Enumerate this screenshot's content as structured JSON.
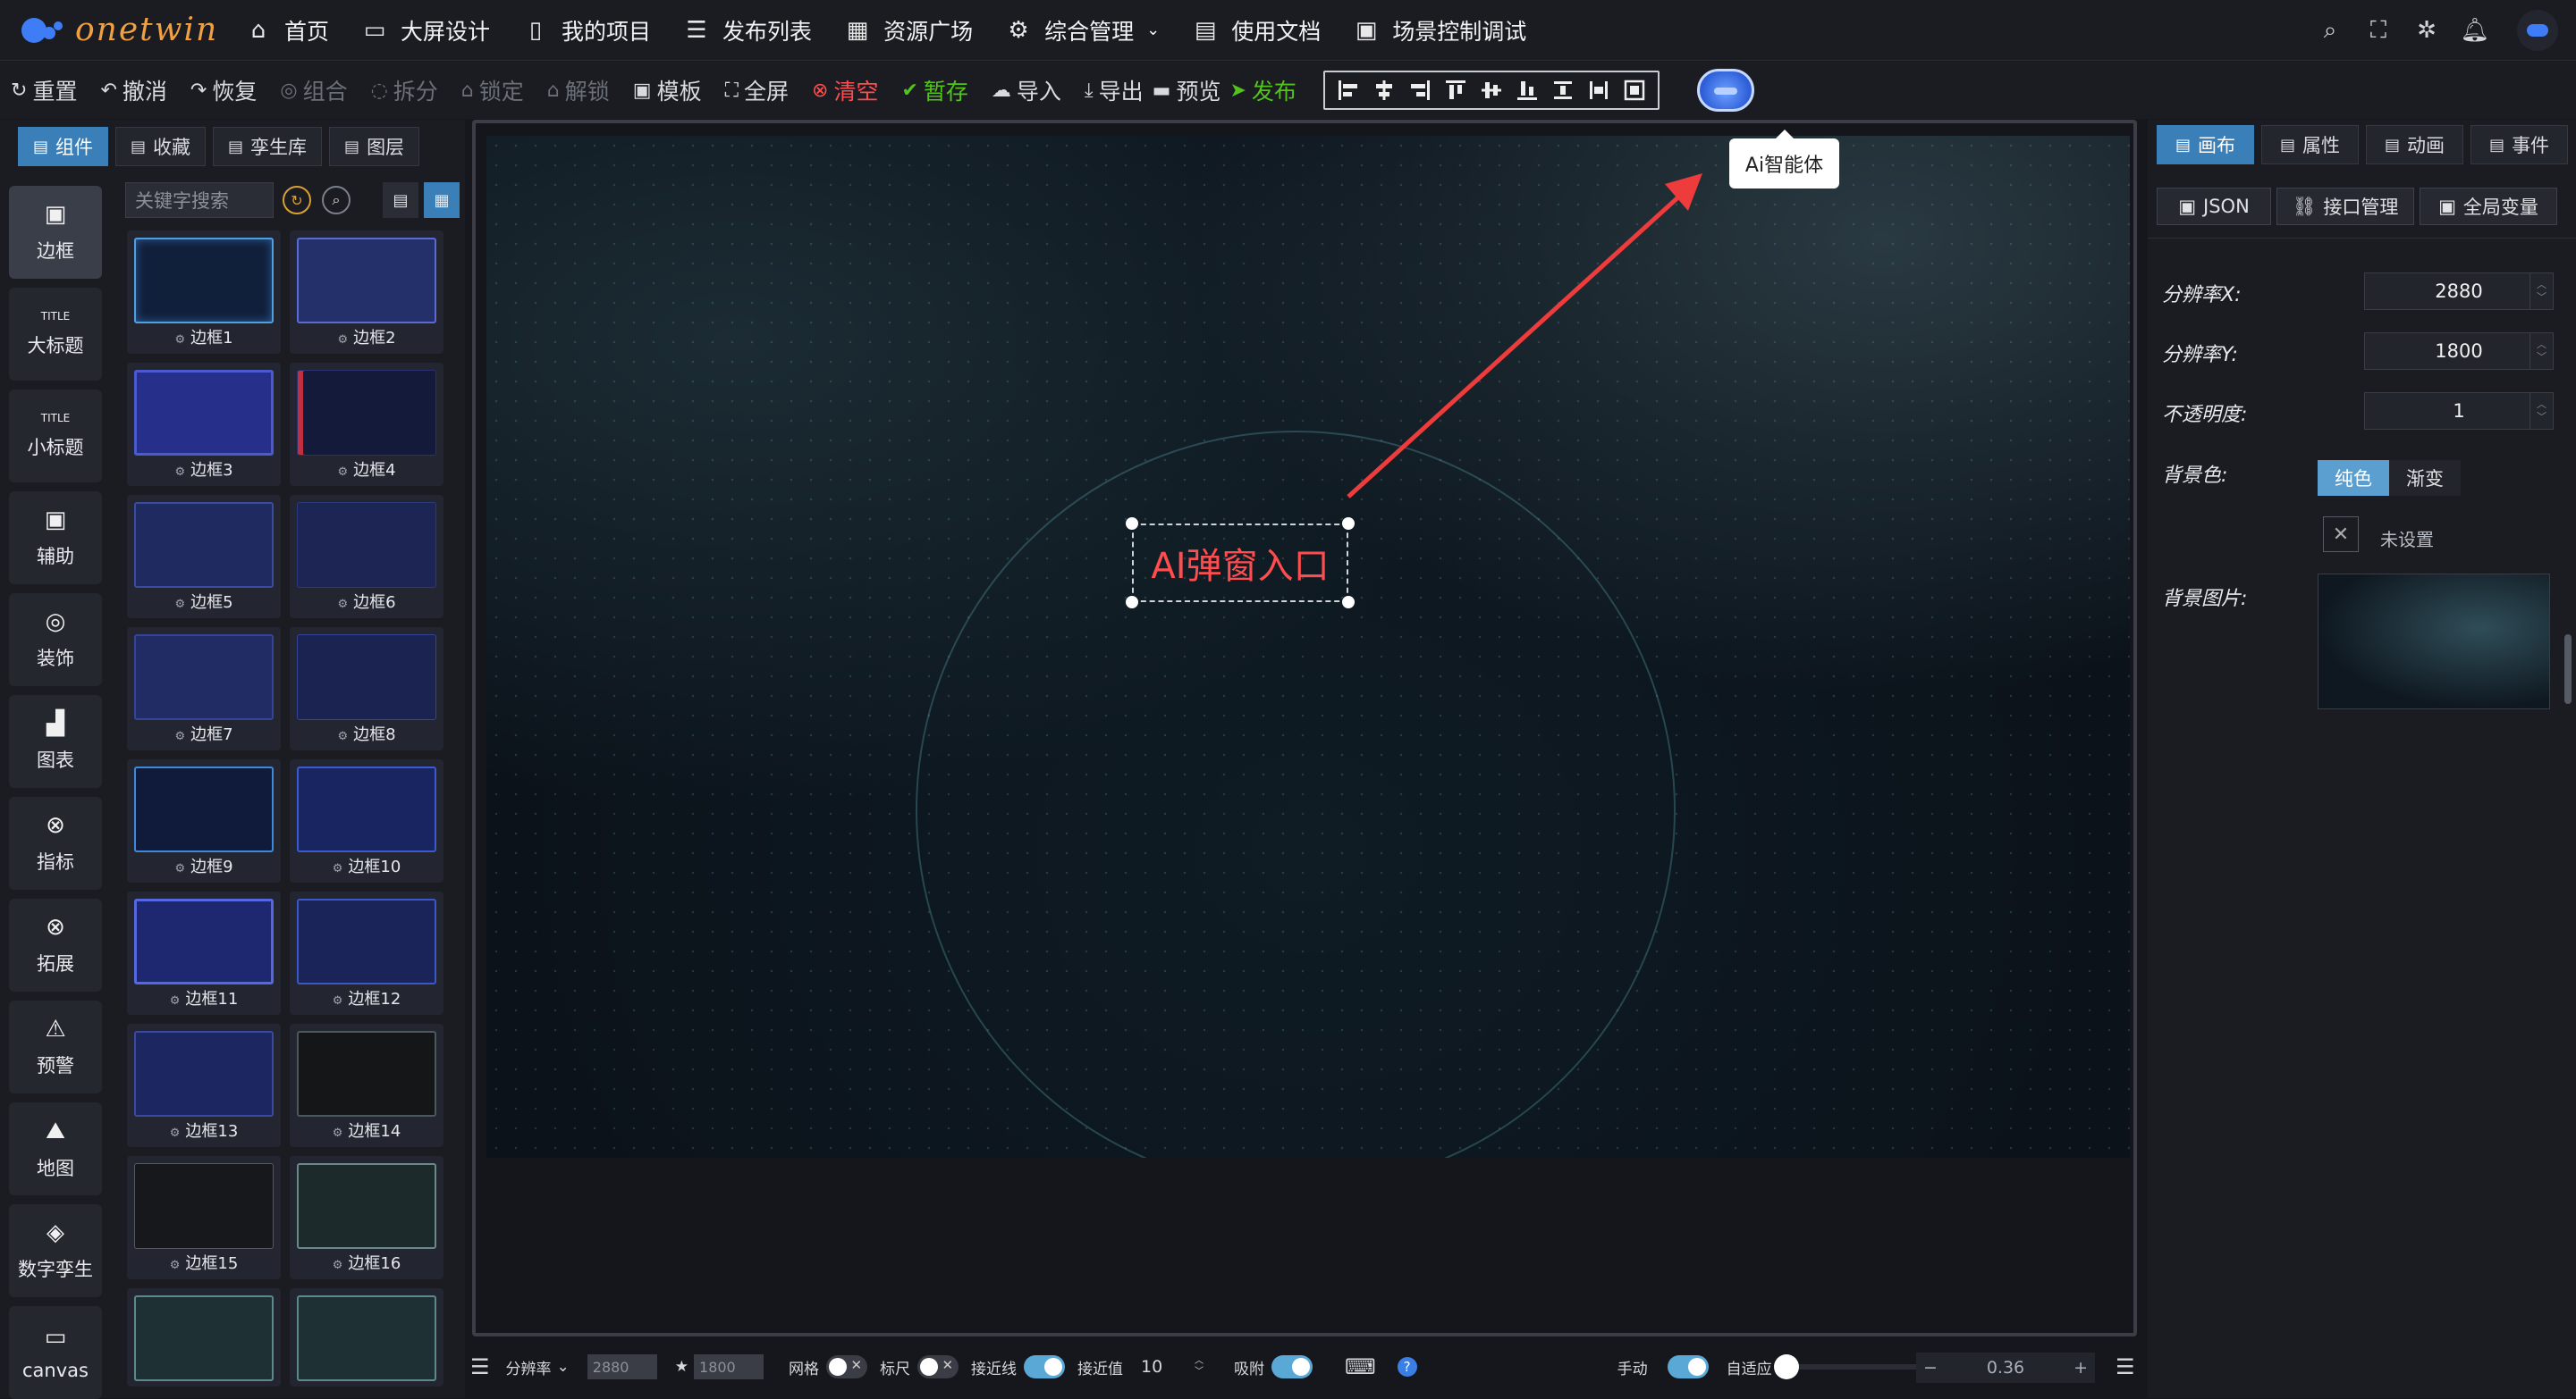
{
  "app": {
    "logo_text": "onetwin"
  },
  "nav": [
    {
      "label": "首页",
      "icon": "home-icon",
      "glyph": "⌂"
    },
    {
      "label": "大屏设计",
      "icon": "monitor-icon",
      "glyph": "▭"
    },
    {
      "label": "我的项目",
      "icon": "book-icon",
      "glyph": "▯"
    },
    {
      "label": "发布列表",
      "icon": "list-icon",
      "glyph": "☰"
    },
    {
      "label": "资源广场",
      "icon": "grid-icon",
      "glyph": "▦"
    },
    {
      "label": "综合管理",
      "icon": "gear-icon",
      "glyph": "⚙"
    },
    {
      "label": "使用文档",
      "icon": "document-icon",
      "glyph": "▤"
    },
    {
      "label": "场景控制调试",
      "icon": "screen-icon",
      "glyph": "▣"
    }
  ],
  "toolbar": {
    "reset": "重置",
    "undo": "撤消",
    "redo": "恢复",
    "group": "组合",
    "split": "拆分",
    "lock": "锁定",
    "unlock": "解锁",
    "template": "模板",
    "fullscreen": "全屏",
    "clear": "清空",
    "save": "暂存",
    "import": "导入",
    "export": "导出",
    "preview": "预览",
    "publish": "发布"
  },
  "tooltip": "Ai智能体",
  "left_nav": [
    "边框",
    "大标题",
    "小标题",
    "辅助",
    "装饰",
    "图表",
    "指标",
    "拓展",
    "预警",
    "地图",
    "数字孪生",
    "canvas"
  ],
  "left_tabs": [
    "组件",
    "收藏",
    "孪生库",
    "图层"
  ],
  "search": {
    "placeholder": "关键字搜索"
  },
  "components": [
    "边框1",
    "边框2",
    "边框3",
    "边框4",
    "边框5",
    "边框6",
    "边框7",
    "边框8",
    "边框9",
    "边框10",
    "边框11",
    "边框12",
    "边框13",
    "边框14",
    "边框15",
    "边框16"
  ],
  "canvas": {
    "ai_label": "AI弹窗入口"
  },
  "bottom": {
    "resolution_label": "分辨率",
    "res_x": "2880",
    "res_y": "1800",
    "grid": "网格",
    "ruler": "标尺",
    "snapline": "接近线",
    "snap_value_label": "接近值",
    "snap_value": "10",
    "adsorb": "吸附",
    "manual": "手动",
    "fit": "自适应",
    "zoom": "0.36"
  },
  "right_tabs": [
    "画布",
    "属性",
    "动画",
    "事件"
  ],
  "right_buttons": [
    "JSON",
    "接口管理",
    "全局变量"
  ],
  "props": {
    "res_x_label": "分辨率X:",
    "res_x": "2880",
    "res_y_label": "分辨率Y:",
    "res_y": "1800",
    "opacity_label": "不透明度:",
    "opacity": "1",
    "bg_color_label": "背景色:",
    "solid": "纯色",
    "gradient": "渐变",
    "unset": "未设置",
    "bg_image_label": "背景图片:"
  },
  "colors": {
    "accent": "#3a7fb8",
    "danger": "#ff4d4f",
    "success": "#52c41a",
    "logo": "#f0a040"
  }
}
